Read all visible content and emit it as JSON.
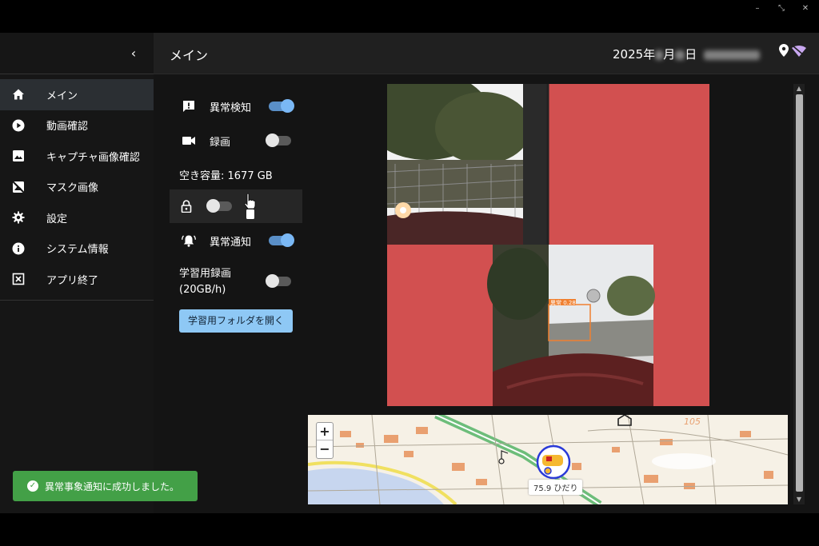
{
  "window": {
    "minimize": "–",
    "restore": "⤡",
    "close": "✕"
  },
  "sidebar": {
    "collapse": "‹",
    "items": [
      {
        "label": "メイン",
        "icon": "home-icon",
        "active": true
      },
      {
        "label": "動画確認",
        "icon": "play-circle-icon",
        "active": false
      },
      {
        "label": "キャプチャ画像確認",
        "icon": "image-icon",
        "active": false
      },
      {
        "label": "マスク画像",
        "icon": "image-off-icon",
        "active": false
      },
      {
        "label": "設定",
        "icon": "gear-icon",
        "active": false
      },
      {
        "label": "システム情報",
        "icon": "info-icon",
        "active": false
      },
      {
        "label": "アプリ終了",
        "icon": "close-box-icon",
        "active": false
      }
    ]
  },
  "header": {
    "title": "メイン",
    "date_prefix": "2025年",
    "date_month": "月",
    "date_day": "日",
    "icons": [
      "location-pin-icon",
      "wifi-off-icon"
    ]
  },
  "controls": {
    "anomaly_detection": {
      "label": "異常検知",
      "on": true,
      "icon": "alert-message-icon"
    },
    "recording": {
      "label": "録画",
      "on": false,
      "icon": "video-camera-icon"
    },
    "free_space": "空き容量: 1677 GB",
    "lock": {
      "on": false,
      "icon": "lock-icon"
    },
    "anomaly_notify": {
      "label": "異常通知",
      "on": true,
      "icon": "bell-alert-icon"
    },
    "training_recording": {
      "label_line1": "学習用録画",
      "label_line2": "(20GB/h)",
      "on": false
    },
    "open_folder_button": "学習用フォルダを開く"
  },
  "camera": {
    "detection_label": "異常 0.28"
  },
  "map": {
    "zoom_in": "+",
    "zoom_out": "−",
    "marker_label": "75.9 ひだり",
    "number_label": "105"
  },
  "toast": {
    "message": "異常事象通知に成功しました。",
    "icon": "check-circle-icon"
  },
  "colors": {
    "accent": "#7ab8f5",
    "toast": "#43a047",
    "feed_background": "#d25050",
    "sidebar": "#161616"
  }
}
